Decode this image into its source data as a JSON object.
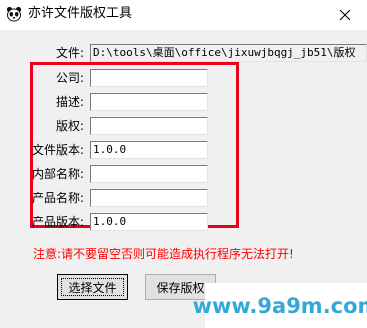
{
  "window": {
    "title": "亦许文件版权工具",
    "close_glyph": "✕"
  },
  "form": {
    "file": {
      "label": "文件:",
      "value": "D:\\tools\\桌面\\office\\jixuwjbqgj_jb51\\版权"
    },
    "company": {
      "label": "公司:",
      "value": ""
    },
    "description": {
      "label": "描述:",
      "value": ""
    },
    "copyright": {
      "label": "版权:",
      "value": ""
    },
    "file_version": {
      "label": "文件版本:",
      "value": "1.0.0"
    },
    "internal_name": {
      "label": "内部名称:",
      "value": ""
    },
    "product_name": {
      "label": "产品名称:",
      "value": ""
    },
    "product_version": {
      "label": "产品版本:",
      "value": "1.0.0"
    }
  },
  "warning": "注意:请不要留空否则可能造成执行程序无法打开!",
  "buttons": {
    "select_file": "选择文件",
    "save_copyright": "保存版权"
  },
  "watermark": "www.9a9m.com",
  "colors": {
    "highlight_box": "#e8001c",
    "warning_text": "#ff0000",
    "watermark": "#34a8d8"
  }
}
